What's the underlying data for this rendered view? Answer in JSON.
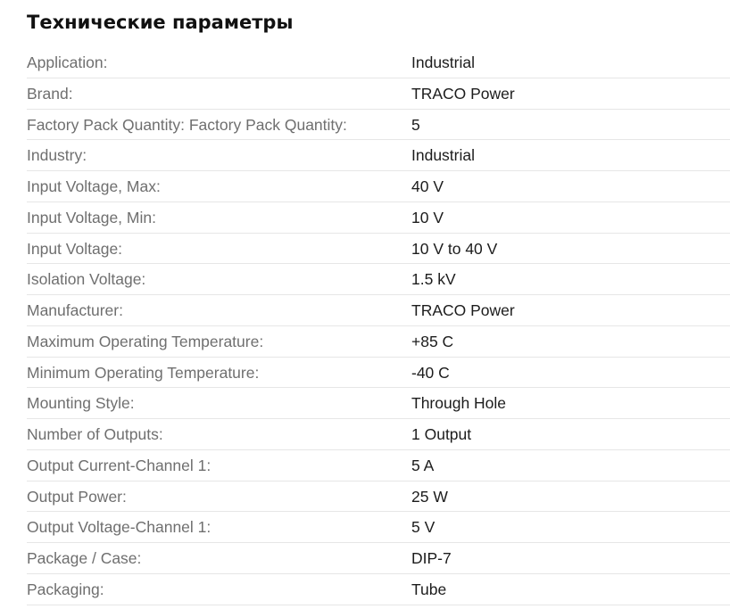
{
  "title": "Технические параметры",
  "specs": [
    {
      "label": "Application:",
      "value": "Industrial"
    },
    {
      "label": "Brand:",
      "value": "TRACO Power"
    },
    {
      "label": "Factory Pack Quantity: Factory Pack Quantity:",
      "value": "5"
    },
    {
      "label": "Industry:",
      "value": "Industrial"
    },
    {
      "label": "Input Voltage, Max:",
      "value": "40 V"
    },
    {
      "label": "Input Voltage, Min:",
      "value": "10 V"
    },
    {
      "label": "Input Voltage:",
      "value": "10 V to 40 V"
    },
    {
      "label": "Isolation Voltage:",
      "value": "1.5 kV"
    },
    {
      "label": "Manufacturer:",
      "value": "TRACO Power"
    },
    {
      "label": "Maximum Operating Temperature:",
      "value": "+85 C"
    },
    {
      "label": "Minimum Operating Temperature:",
      "value": "-40 C"
    },
    {
      "label": "Mounting Style:",
      "value": "Through Hole"
    },
    {
      "label": "Number of Outputs:",
      "value": "1 Output"
    },
    {
      "label": "Output Current-Channel 1:",
      "value": "5 A"
    },
    {
      "label": "Output Power:",
      "value": "25 W"
    },
    {
      "label": "Output Voltage-Channel 1:",
      "value": "5 V"
    },
    {
      "label": "Package / Case:",
      "value": "DIP-7"
    },
    {
      "label": "Packaging:",
      "value": "Tube"
    }
  ]
}
